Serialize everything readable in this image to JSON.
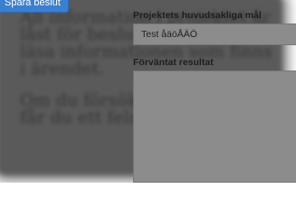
{
  "toolbar": {
    "save_label": "Spara beslut"
  },
  "message": {
    "paragraphs": [
      "All information i projektet är låst för beslut. Du kan dock läsa informationen som finns i ärendet.",
      "Om du försöker ändra något får du ett felmeddelande."
    ]
  },
  "form": {
    "goal_label": "Projektets huvudsakliga mål",
    "goal_value": "Test åäöÅÄÖ",
    "result_label": "Förväntat resultat",
    "result_value": ""
  },
  "colors": {
    "accent": "#3b7fd0",
    "overlay": "#8c8c8c"
  }
}
